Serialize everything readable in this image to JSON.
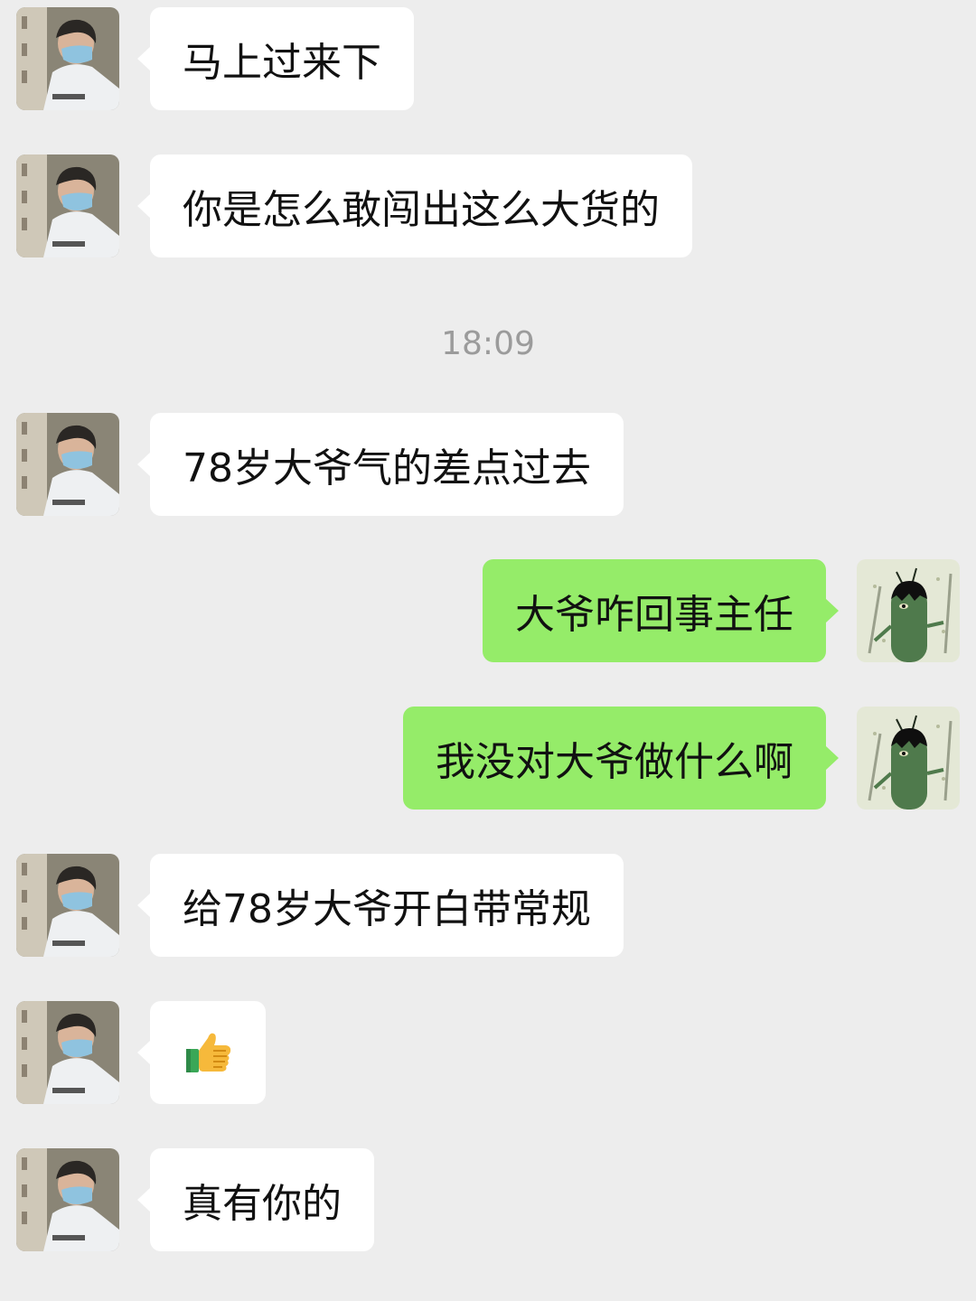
{
  "timestamp": "18:09",
  "messages": [
    {
      "side": "in",
      "text": "马上过来下"
    },
    {
      "side": "in",
      "text": "你是怎么敢闯出这么大货的"
    },
    {
      "side": "in",
      "text": "78岁大爷气的差点过去"
    },
    {
      "side": "out",
      "text": "大爷咋回事主任"
    },
    {
      "side": "out",
      "text": "我没对大爷做什么啊"
    },
    {
      "side": "in",
      "text": "给78岁大爷开白带常规"
    },
    {
      "side": "in",
      "emoji": "thumbs-up-icon"
    },
    {
      "side": "in",
      "text": "真有你的"
    }
  ],
  "colors": {
    "background": "#ededed",
    "incoming_bubble": "#ffffff",
    "outgoing_bubble": "#95ec69",
    "timestamp_text": "#9b9b9b"
  }
}
